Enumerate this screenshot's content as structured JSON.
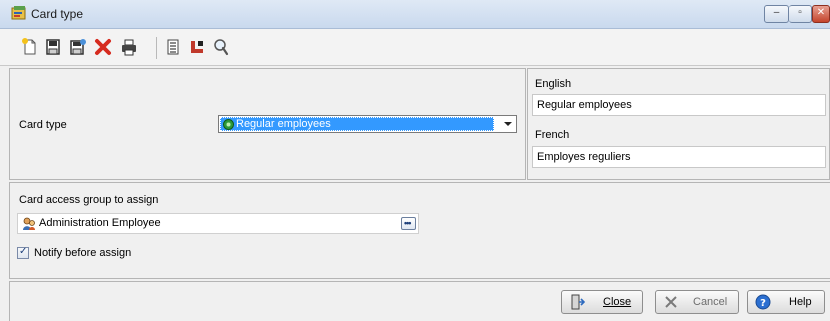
{
  "window": {
    "title": "Card type",
    "controls": {
      "minimize": "–",
      "maximize": "▫",
      "close": "✕"
    }
  },
  "toolbar": {
    "items": [
      {
        "name": "new-icon"
      },
      {
        "name": "save-icon"
      },
      {
        "name": "save-and-new-icon"
      },
      {
        "name": "delete-icon"
      },
      {
        "name": "print-icon"
      },
      {
        "name": "list-icon"
      },
      {
        "name": "link-icon"
      },
      {
        "name": "search-icon"
      }
    ]
  },
  "form": {
    "card_type_label": "Card type",
    "card_type_value": "Regular employees",
    "english_label": "English",
    "english_value": "Regular employees",
    "french_label": "French",
    "french_value": "Employes reguliers",
    "access_group_label": "Card access group to assign",
    "access_group_value": "Administration Employee",
    "notify_label": "Notify before assign",
    "notify_checked": true
  },
  "buttons": {
    "close": "Close",
    "cancel": "Cancel",
    "help": "Help"
  },
  "colors": {
    "selection": "#3399ff",
    "titlebar": "#dfe9f5",
    "delete_icon": "#d62b1f"
  }
}
